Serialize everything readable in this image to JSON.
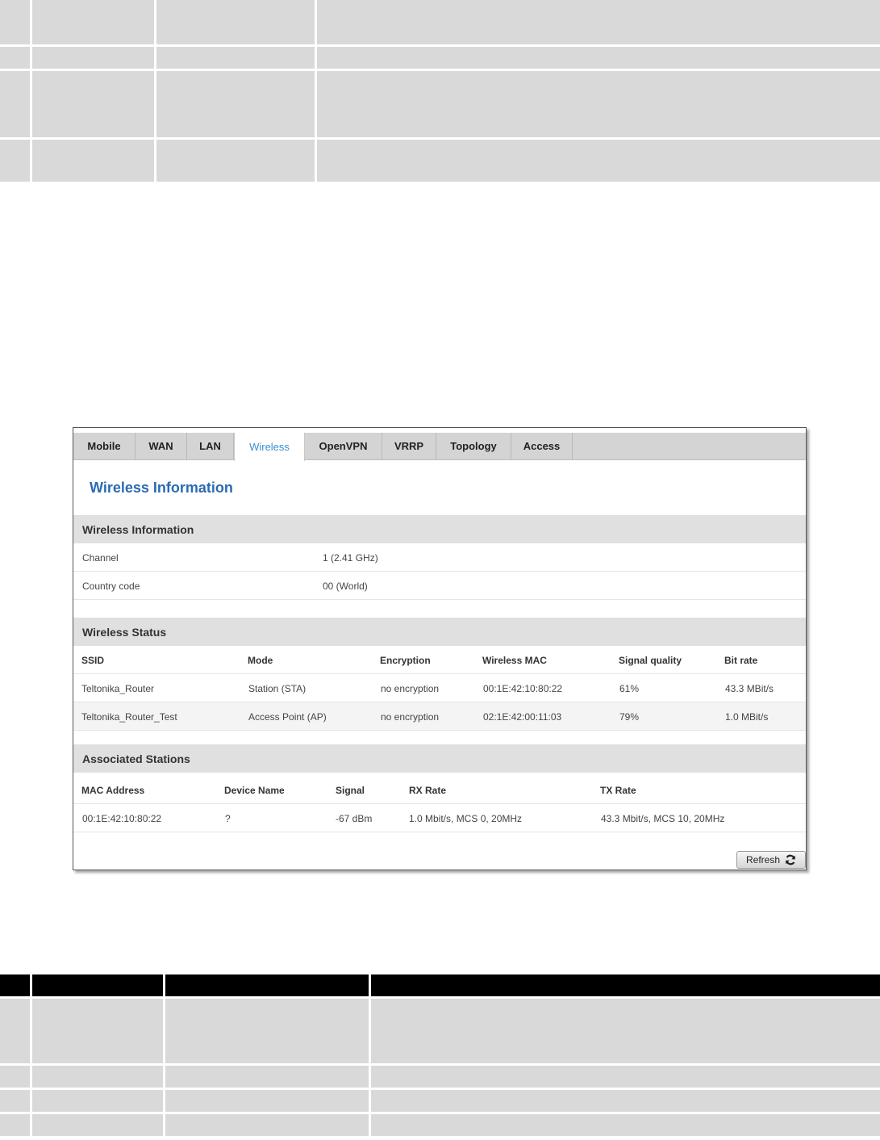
{
  "tabs": [
    {
      "label": "Mobile",
      "active": false
    },
    {
      "label": "WAN",
      "active": false
    },
    {
      "label": "LAN",
      "active": false
    },
    {
      "label": "Wireless",
      "active": true
    },
    {
      "label": "OpenVPN",
      "active": false
    },
    {
      "label": "VRRP",
      "active": false
    },
    {
      "label": "Topology",
      "active": false
    },
    {
      "label": "Access",
      "active": false
    }
  ],
  "page_title": "Wireless Information",
  "wireless_info": {
    "heading": "Wireless Information",
    "rows": [
      {
        "label": "Channel",
        "value": "1 (2.41 GHz)"
      },
      {
        "label": "Country code",
        "value": "00 (World)"
      }
    ]
  },
  "wireless_status": {
    "heading": "Wireless Status",
    "columns": [
      "SSID",
      "Mode",
      "Encryption",
      "Wireless MAC",
      "Signal quality",
      "Bit rate"
    ],
    "rows": [
      [
        "Teltonika_Router",
        "Station (STA)",
        "no encryption",
        "00:1E:42:10:80:22",
        "61%",
        "43.3 MBit/s"
      ],
      [
        "Teltonika_Router_Test",
        "Access Point (AP)",
        "no encryption",
        "02:1E:42:00:11:03",
        "79%",
        "1.0 MBit/s"
      ]
    ]
  },
  "associated_stations": {
    "heading": "Associated Stations",
    "columns": [
      "MAC Address",
      "Device Name",
      "Signal",
      "RX Rate",
      "TX Rate"
    ],
    "rows": [
      [
        "00:1E:42:10:80:22",
        "?",
        "-67 dBm",
        "1.0 Mbit/s, MCS 0, 20MHz",
        "43.3 Mbit/s, MCS 10, 20MHz"
      ]
    ]
  },
  "refresh_label": "Refresh",
  "icons": {
    "refresh": "refresh-icon"
  },
  "colors": {
    "accent": "#2a6bb3",
    "active_tab": "#3a8fd6",
    "section_bg": "#e0e0e0",
    "tabbar_bg": "#d4d4d4"
  }
}
